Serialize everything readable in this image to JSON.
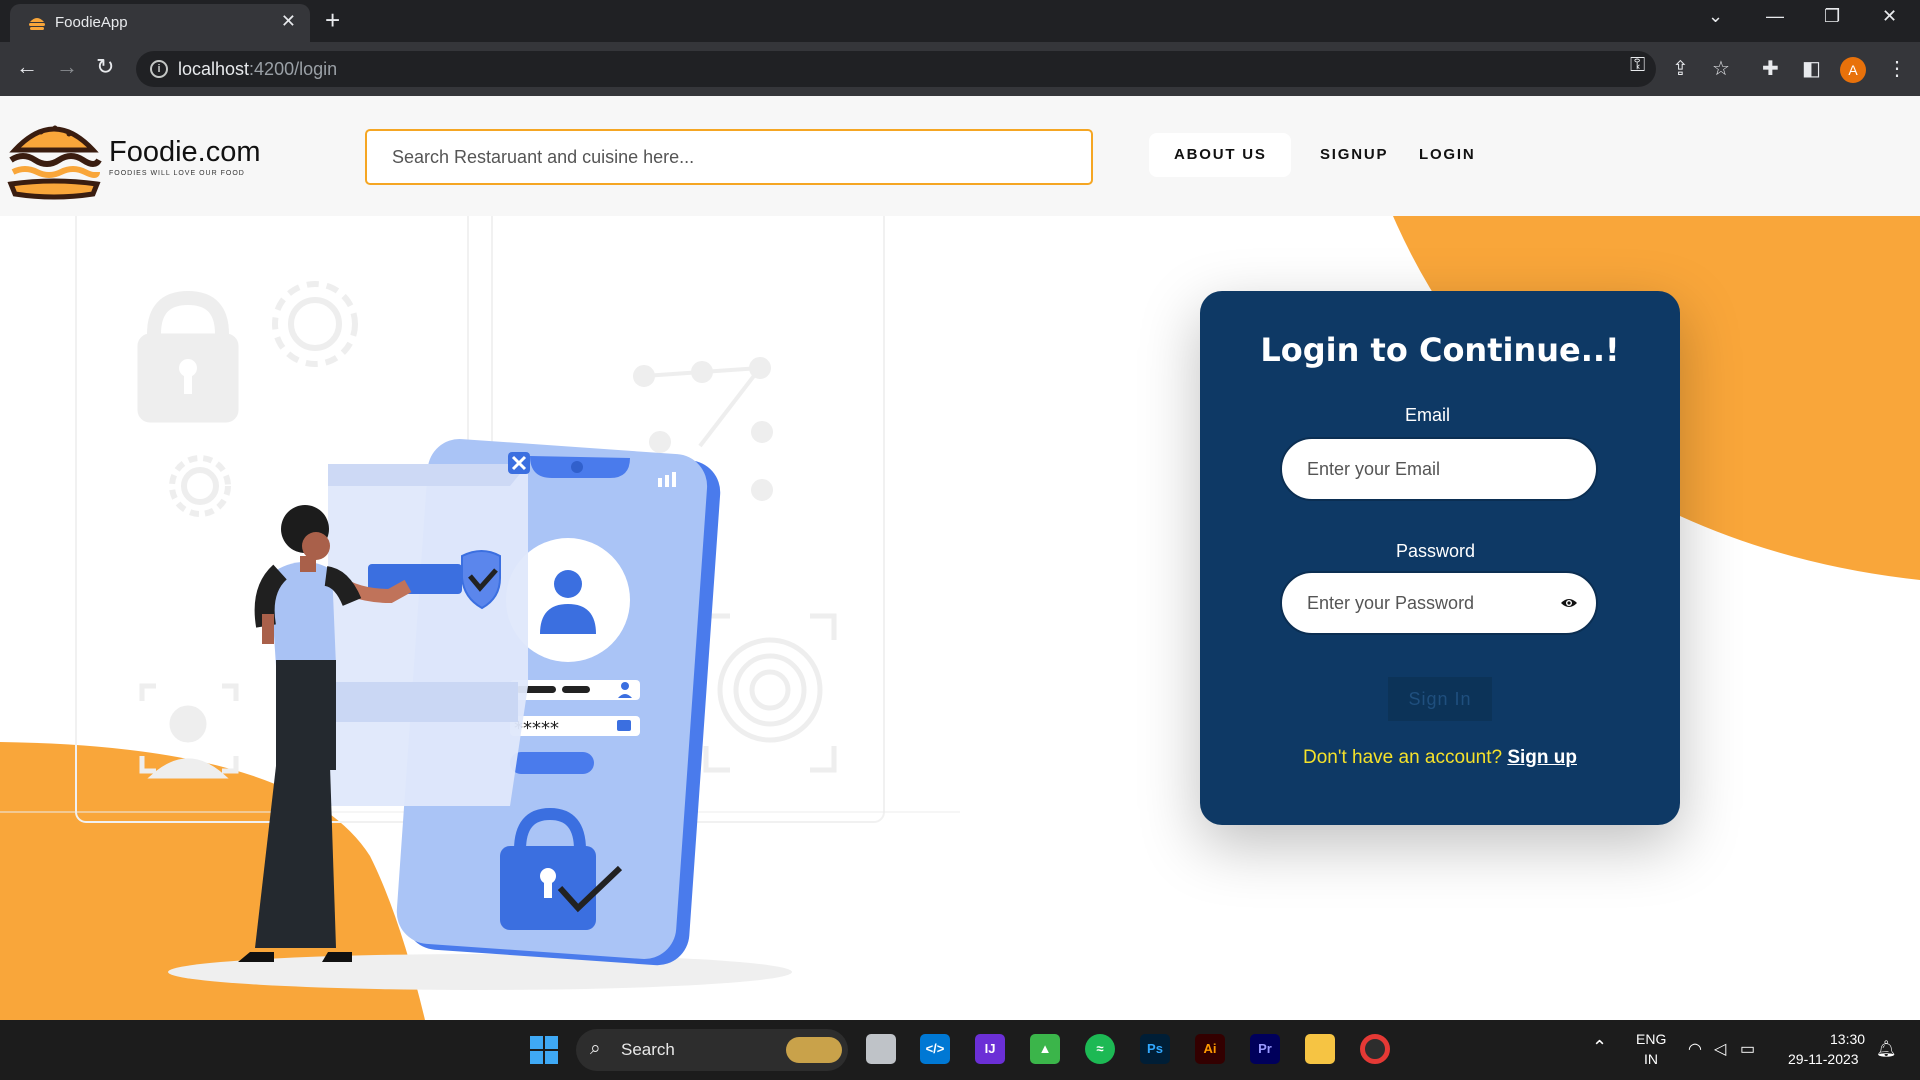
{
  "browser": {
    "tab_title": "FoodieApp",
    "new_tab": "+",
    "url_host": "localhost",
    "url_rest": ":4200/login",
    "profile_initial": "A"
  },
  "header": {
    "brand": "Foodie.com",
    "tagline": "FOODIES WILL LOVE OUR FOOD",
    "search_placeholder": "Search Restaruant and cuisine here...",
    "nav": {
      "about": "ABOUT US",
      "signup": "SIGNUP",
      "login": "LOGIN"
    }
  },
  "login_card": {
    "title": "Login to Continue..!",
    "email_label": "Email",
    "email_placeholder": "Enter your Email",
    "password_label": "Password",
    "password_placeholder": "Enter your Password",
    "submit_label": "Sign In",
    "signup_prompt": "Don't have an account?",
    "signup_link": "Sign up"
  },
  "taskbar": {
    "search_label": "Search",
    "lang_top": "ENG",
    "lang_bottom": "IN",
    "time": "13:30",
    "date": "29-11-2023",
    "apps": [
      "windows-start",
      "task-view",
      "vscode",
      "intellij",
      "bluestacks",
      "spotify",
      "photoshop",
      "illustrator",
      "premiere",
      "file-explorer",
      "chrome"
    ]
  },
  "colors": {
    "accent_orange": "#f9a63a",
    "card_navy": "#0e3965",
    "signup_prompt_yellow": "#f5e12a",
    "search_border": "#f5a623"
  }
}
